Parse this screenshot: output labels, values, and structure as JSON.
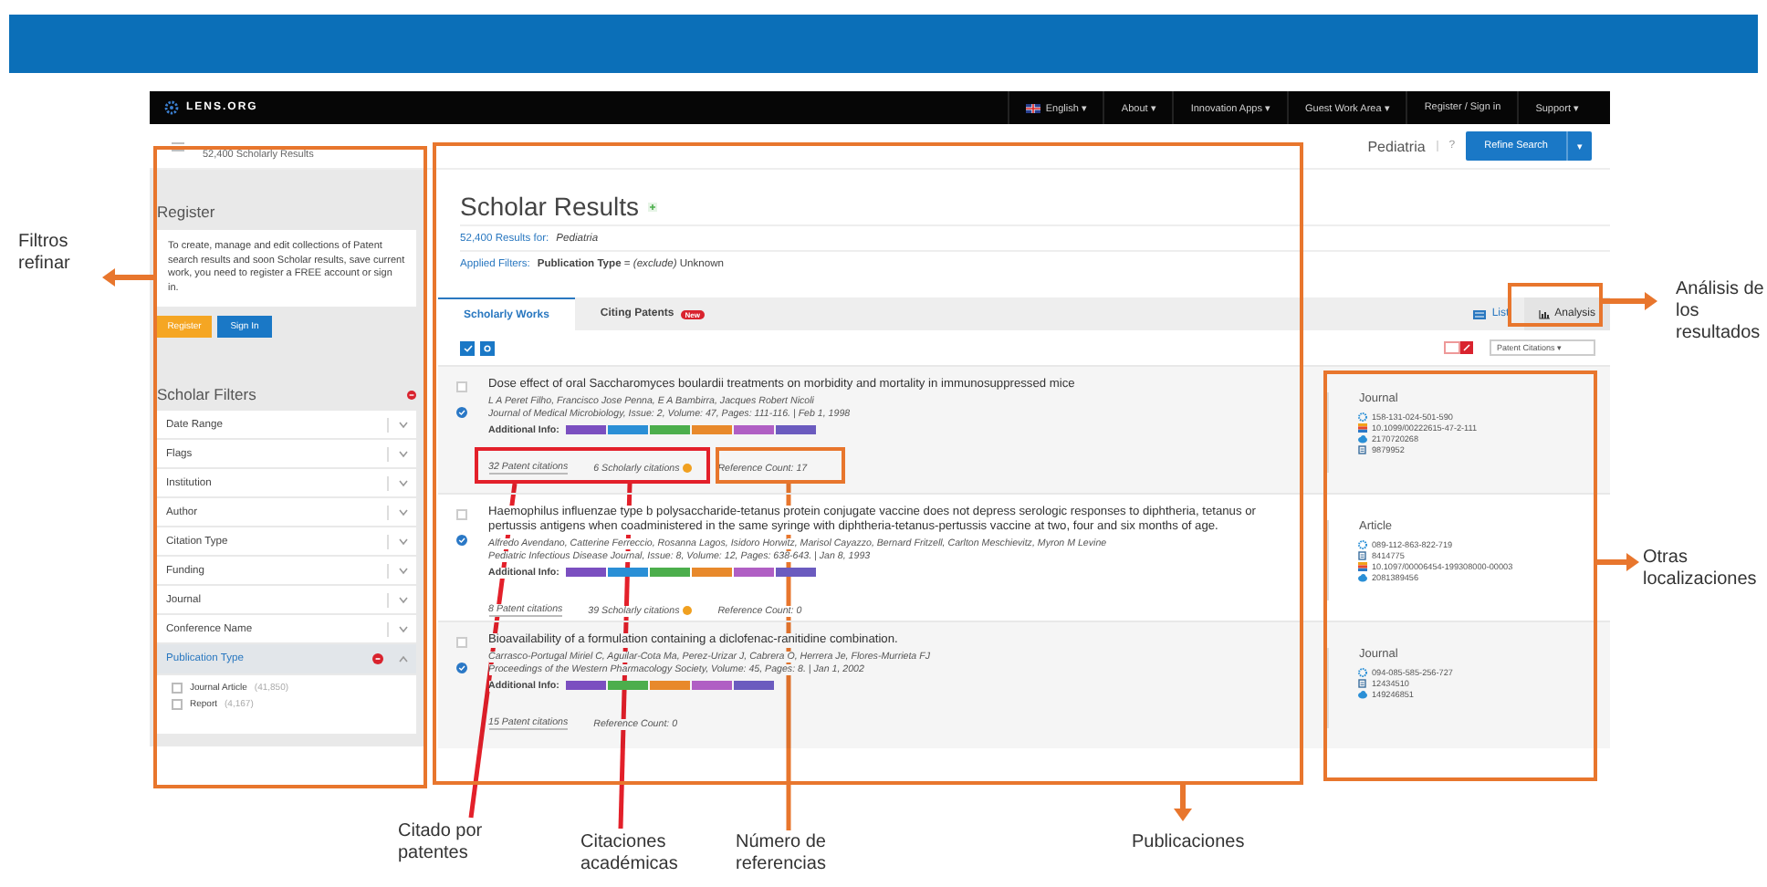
{
  "nav": {
    "logo": "LENS.ORG",
    "items": [
      {
        "label": "English ▾",
        "kind": "language"
      },
      {
        "label": "About ▾",
        "kind": "link"
      },
      {
        "label": "Innovation Apps ▾",
        "kind": "link"
      },
      {
        "label": "Guest Work Area ▾",
        "kind": "link"
      },
      {
        "label": "Register / Sign in",
        "kind": "link"
      },
      {
        "label": "Support ▾",
        "kind": "link"
      }
    ]
  },
  "subbar": {
    "breadcrumb": "52,400 Scholarly Results",
    "query": "Pediatria",
    "help": "?",
    "refine_button": "Refine Search",
    "refine_caret": "▾"
  },
  "sidebar": {
    "register": {
      "title": "Register",
      "text": "To create, manage and edit collections of Patent search results and soon Scholar results, save current work, you need to register a FREE account or sign in.",
      "buttons": [
        {
          "label": "Register",
          "kind": "warning"
        },
        {
          "label": "Sign In",
          "kind": "primary"
        }
      ]
    },
    "filters": {
      "title": "Scholar Filters",
      "items": [
        {
          "label": "Date Range",
          "expanded": false
        },
        {
          "label": "Flags",
          "expanded": false
        },
        {
          "label": "Institution",
          "expanded": false
        },
        {
          "label": "Author",
          "expanded": false
        },
        {
          "label": "Citation Type",
          "expanded": false
        },
        {
          "label": "Funding",
          "expanded": false
        },
        {
          "label": "Journal",
          "expanded": false
        },
        {
          "label": "Conference Name",
          "expanded": false
        },
        {
          "label": "Publication Type",
          "expanded": true,
          "options": [
            {
              "label": "Journal Article",
              "count": "(41,850)",
              "checked": false
            },
            {
              "label": "Report",
              "count": "(4,167)",
              "checked": false
            }
          ]
        }
      ]
    }
  },
  "main": {
    "title": "Scholar Results",
    "results_label": "52,400 Results for:",
    "query": "Pediatria",
    "filters_label": "Applied Filters:",
    "filters_value": "**Publication Type** = *(exclude)* Unknown",
    "tabs": [
      {
        "label": "Scholarly Works",
        "selected": true
      },
      {
        "label": "Citing Patents",
        "selected": false,
        "badge": "New"
      }
    ],
    "views": [
      {
        "label": "List",
        "selected": true
      },
      {
        "label": "Analysis",
        "selected": false
      }
    ],
    "sort": "Patent Citations ▾",
    "results": [
      {
        "title": "Dose effect of oral Saccharomyces boulardii treatments on morbidity and mortality in immunosuppressed mice",
        "authors": "L A Peret Filho, Francisco Jose Penna, E A Bambirra, Jacques Robert Nicoli",
        "source": "Journal of Medical Microbiology, Issue: 2, Volume: 47, Pages: 111-116. | Feb 1, 1998",
        "checked": false,
        "open_access": true,
        "info_label": "Additional Info:",
        "tags": [
          {
            "color": "#7b4fc0"
          },
          {
            "color": "#2a8fd6"
          },
          {
            "color": "#4cae4c"
          },
          {
            "color": "#e8892b"
          },
          {
            "color": "#b05fc4"
          },
          {
            "color": "#6b5bbf"
          }
        ],
        "patent_citations": "32 Patent citations",
        "scholarly_citations": "6 Scholarly citations",
        "reference_count": "Reference Count: 17",
        "side": {
          "type": "Journal",
          "ids": [
            {
              "kind": "lens",
              "value": "158-131-024-501-590"
            },
            {
              "kind": "doi",
              "value": "10.1099/00222615-47-2-111"
            },
            {
              "kind": "mag",
              "value": "2170720268"
            },
            {
              "kind": "pmid",
              "value": "9879952"
            }
          ]
        }
      },
      {
        "title": "Haemophilus influenzae type b polysaccharide-tetanus protein conjugate vaccine does not depress serologic responses to diphtheria, tetanus or pertussis antigens when coadministered in the same syringe with diphtheria-tetanus-pertussis vaccine at two, four and six months of age.",
        "authors": "Alfredo Avendano, Catterine Ferreccio, Rosanna Lagos, Isidoro Horwitz, Marisol Cayazzo, Bernard Fritzell, Carlton Meschievitz, Myron M Levine",
        "source": "Pediatric Infectious Disease Journal, Issue: 8, Volume: 12, Pages: 638-643. | Jan 8, 1993",
        "checked": false,
        "open_access": true,
        "info_label": "Additional Info:",
        "tags": [
          {
            "color": "#7b4fc0"
          },
          {
            "color": "#2a8fd6"
          },
          {
            "color": "#4cae4c"
          },
          {
            "color": "#e8892b"
          },
          {
            "color": "#b05fc4"
          },
          {
            "color": "#6b5bbf"
          }
        ],
        "patent_citations": "8 Patent citations",
        "scholarly_citations": "39 Scholarly citations",
        "reference_count": "Reference Count: 0",
        "side": {
          "type": "Article",
          "ids": [
            {
              "kind": "lens",
              "value": "089-112-863-822-719"
            },
            {
              "kind": "pmid",
              "value": "8414775"
            },
            {
              "kind": "doi",
              "value": "10.1097/00006454-199308000-00003"
            },
            {
              "kind": "mag",
              "value": "2081389456"
            }
          ]
        }
      },
      {
        "title": "Bioavailability of a formulation containing a diclofenac-ranitidine combination.",
        "authors": "Carrasco-Portugal Miriel C, Aguilar-Cota Ma, Perez-Urizar J, Cabrera O, Herrera Je, Flores-Murrieta FJ",
        "source": "Proceedings of the Western Pharmacology Society, Volume: 45, Pages: 8. | Jan 1, 2002",
        "checked": false,
        "open_access": true,
        "info_label": "Additional Info:",
        "tags": [
          {
            "color": "#7b4fc0"
          },
          {
            "color": "#4cae4c"
          },
          {
            "color": "#e8892b"
          },
          {
            "color": "#b05fc4"
          },
          {
            "color": "#6b5bbf"
          }
        ],
        "patent_citations": "15 Patent citations",
        "reference_count": "Reference Count: 0",
        "side": {
          "type": "Journal",
          "ids": [
            {
              "kind": "lens",
              "value": "094-085-585-256-727"
            },
            {
              "kind": "pmid",
              "value": "12434510"
            },
            {
              "kind": "mag",
              "value": "149246851"
            }
          ]
        }
      }
    ]
  },
  "annotations": [
    {
      "label": "Filtros refinar"
    },
    {
      "label": "Análisis de los resultados"
    },
    {
      "label": "Otras localizaciones"
    },
    {
      "label": "Citado por patentes"
    },
    {
      "label": "Citaciones académicas"
    },
    {
      "label": "Número de referencias"
    },
    {
      "label": "Publicaciones"
    }
  ]
}
